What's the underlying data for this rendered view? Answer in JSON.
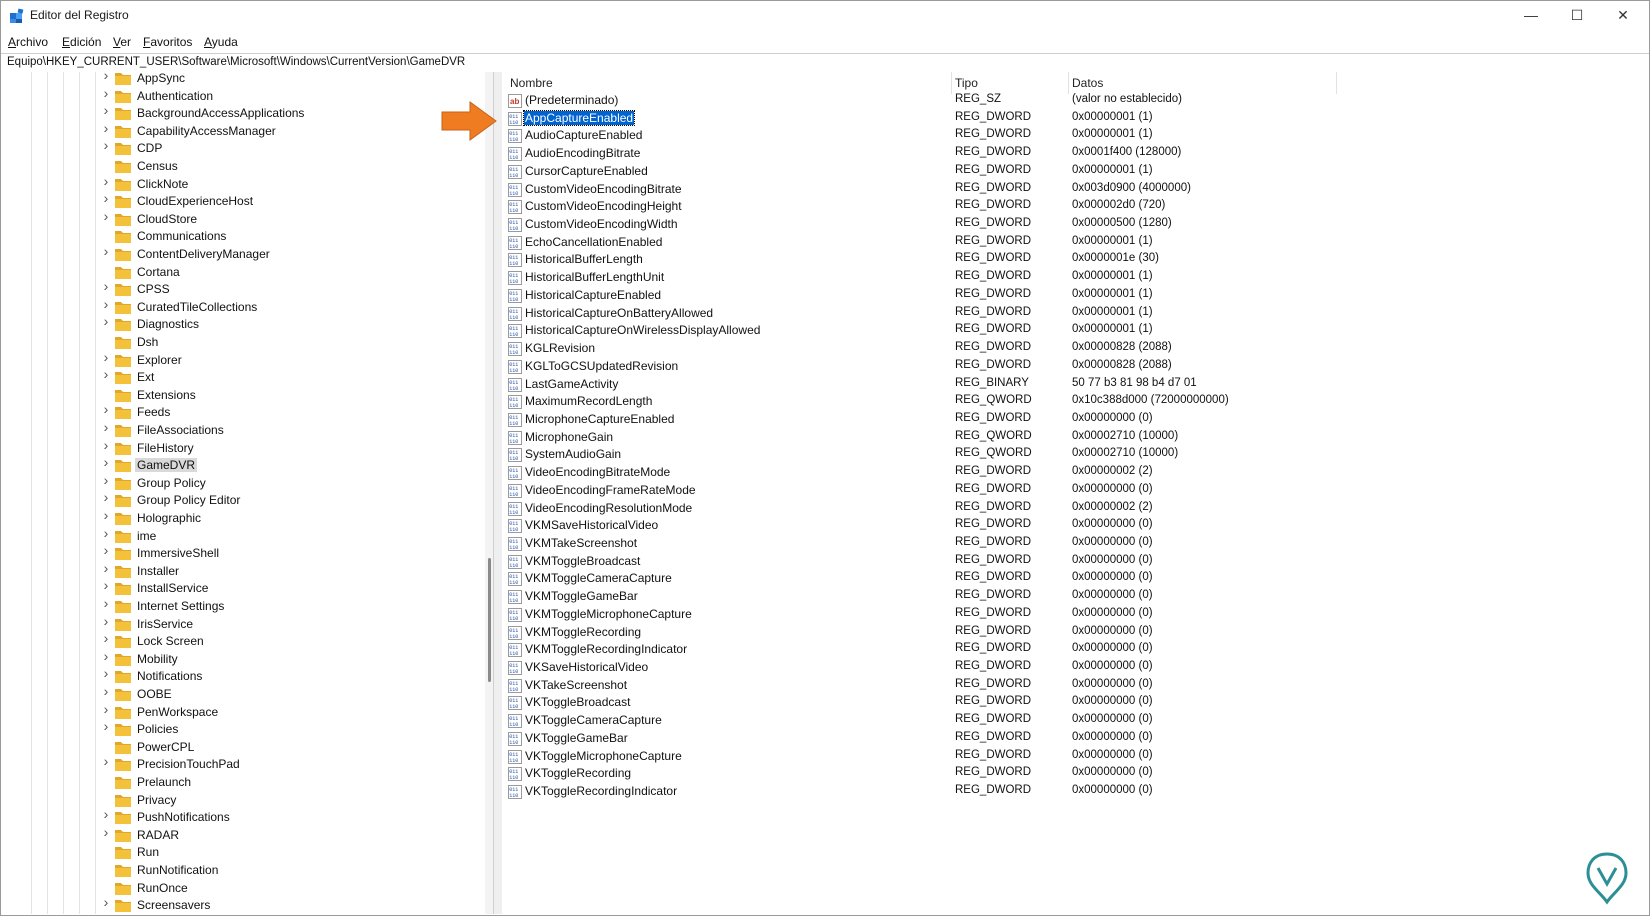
{
  "window": {
    "title": "Editor del Registro",
    "minimize_glyph": "—",
    "maximize_glyph": "☐",
    "close_glyph": "✕"
  },
  "menu": [
    {
      "label": "Archivo",
      "key": "A",
      "rest": "rchivo"
    },
    {
      "label": "Edición",
      "key": "E",
      "rest": "dición"
    },
    {
      "label": "Ver",
      "key": "V",
      "rest": "er"
    },
    {
      "label": "Favoritos",
      "key": "F",
      "rest": "avoritos"
    },
    {
      "label": "Ayuda",
      "key": "A",
      "rest": "yuda"
    }
  ],
  "address": "Equipo\\HKEY_CURRENT_USER\\Software\\Microsoft\\Windows\\CurrentVersion\\GameDVR",
  "tree": {
    "selected": "GameDVR",
    "items": [
      {
        "label": "AppSync",
        "expandable": true
      },
      {
        "label": "Authentication",
        "expandable": true
      },
      {
        "label": "BackgroundAccessApplications",
        "expandable": true
      },
      {
        "label": "CapabilityAccessManager",
        "expandable": true
      },
      {
        "label": "CDP",
        "expandable": true
      },
      {
        "label": "Census",
        "expandable": false
      },
      {
        "label": "ClickNote",
        "expandable": true
      },
      {
        "label": "CloudExperienceHost",
        "expandable": true
      },
      {
        "label": "CloudStore",
        "expandable": true
      },
      {
        "label": "Communications",
        "expandable": false
      },
      {
        "label": "ContentDeliveryManager",
        "expandable": true
      },
      {
        "label": "Cortana",
        "expandable": false
      },
      {
        "label": "CPSS",
        "expandable": true
      },
      {
        "label": "CuratedTileCollections",
        "expandable": true
      },
      {
        "label": "Diagnostics",
        "expandable": true
      },
      {
        "label": "Dsh",
        "expandable": false
      },
      {
        "label": "Explorer",
        "expandable": true
      },
      {
        "label": "Ext",
        "expandable": true
      },
      {
        "label": "Extensions",
        "expandable": false
      },
      {
        "label": "Feeds",
        "expandable": true
      },
      {
        "label": "FileAssociations",
        "expandable": true
      },
      {
        "label": "FileHistory",
        "expandable": true
      },
      {
        "label": "GameDVR",
        "expandable": true
      },
      {
        "label": "Group Policy",
        "expandable": true
      },
      {
        "label": "Group Policy Editor",
        "expandable": true
      },
      {
        "label": "Holographic",
        "expandable": true
      },
      {
        "label": "ime",
        "expandable": true
      },
      {
        "label": "ImmersiveShell",
        "expandable": true
      },
      {
        "label": "Installer",
        "expandable": true
      },
      {
        "label": "InstallService",
        "expandable": true
      },
      {
        "label": "Internet Settings",
        "expandable": true
      },
      {
        "label": "IrisService",
        "expandable": true
      },
      {
        "label": "Lock Screen",
        "expandable": true
      },
      {
        "label": "Mobility",
        "expandable": true
      },
      {
        "label": "Notifications",
        "expandable": true
      },
      {
        "label": "OOBE",
        "expandable": true
      },
      {
        "label": "PenWorkspace",
        "expandable": true
      },
      {
        "label": "Policies",
        "expandable": true
      },
      {
        "label": "PowerCPL",
        "expandable": false
      },
      {
        "label": "PrecisionTouchPad",
        "expandable": true
      },
      {
        "label": "Prelaunch",
        "expandable": false
      },
      {
        "label": "Privacy",
        "expandable": false
      },
      {
        "label": "PushNotifications",
        "expandable": true
      },
      {
        "label": "RADAR",
        "expandable": true
      },
      {
        "label": "Run",
        "expandable": false
      },
      {
        "label": "RunNotification",
        "expandable": false
      },
      {
        "label": "RunOnce",
        "expandable": false
      },
      {
        "label": "Screensavers",
        "expandable": true
      }
    ]
  },
  "columns": {
    "name": "Nombre",
    "type": "Tipo",
    "data": "Datos"
  },
  "values": [
    {
      "name": "(Predeterminado)",
      "type": "REG_SZ",
      "data": "(valor no establecido)",
      "icon": "string-value-icon"
    },
    {
      "name": "AppCaptureEnabled",
      "type": "REG_DWORD",
      "data": "0x00000001 (1)",
      "icon": "binary-value-icon",
      "selected": true
    },
    {
      "name": "AudioCaptureEnabled",
      "type": "REG_DWORD",
      "data": "0x00000001 (1)",
      "icon": "binary-value-icon"
    },
    {
      "name": "AudioEncodingBitrate",
      "type": "REG_DWORD",
      "data": "0x0001f400 (128000)",
      "icon": "binary-value-icon"
    },
    {
      "name": "CursorCaptureEnabled",
      "type": "REG_DWORD",
      "data": "0x00000001 (1)",
      "icon": "binary-value-icon"
    },
    {
      "name": "CustomVideoEncodingBitrate",
      "type": "REG_DWORD",
      "data": "0x003d0900 (4000000)",
      "icon": "binary-value-icon"
    },
    {
      "name": "CustomVideoEncodingHeight",
      "type": "REG_DWORD",
      "data": "0x000002d0 (720)",
      "icon": "binary-value-icon"
    },
    {
      "name": "CustomVideoEncodingWidth",
      "type": "REG_DWORD",
      "data": "0x00000500 (1280)",
      "icon": "binary-value-icon"
    },
    {
      "name": "EchoCancellationEnabled",
      "type": "REG_DWORD",
      "data": "0x00000001 (1)",
      "icon": "binary-value-icon"
    },
    {
      "name": "HistoricalBufferLength",
      "type": "REG_DWORD",
      "data": "0x0000001e (30)",
      "icon": "binary-value-icon"
    },
    {
      "name": "HistoricalBufferLengthUnit",
      "type": "REG_DWORD",
      "data": "0x00000001 (1)",
      "icon": "binary-value-icon"
    },
    {
      "name": "HistoricalCaptureEnabled",
      "type": "REG_DWORD",
      "data": "0x00000001 (1)",
      "icon": "binary-value-icon"
    },
    {
      "name": "HistoricalCaptureOnBatteryAllowed",
      "type": "REG_DWORD",
      "data": "0x00000001 (1)",
      "icon": "binary-value-icon"
    },
    {
      "name": "HistoricalCaptureOnWirelessDisplayAllowed",
      "type": "REG_DWORD",
      "data": "0x00000001 (1)",
      "icon": "binary-value-icon"
    },
    {
      "name": "KGLRevision",
      "type": "REG_DWORD",
      "data": "0x00000828 (2088)",
      "icon": "binary-value-icon"
    },
    {
      "name": "KGLToGCSUpdatedRevision",
      "type": "REG_DWORD",
      "data": "0x00000828 (2088)",
      "icon": "binary-value-icon"
    },
    {
      "name": "LastGameActivity",
      "type": "REG_BINARY",
      "data": "50 77 b3 81 98 b4 d7 01",
      "icon": "binary-value-icon"
    },
    {
      "name": "MaximumRecordLength",
      "type": "REG_QWORD",
      "data": "0x10c388d000 (72000000000)",
      "icon": "binary-value-icon"
    },
    {
      "name": "MicrophoneCaptureEnabled",
      "type": "REG_DWORD",
      "data": "0x00000000 (0)",
      "icon": "binary-value-icon"
    },
    {
      "name": "MicrophoneGain",
      "type": "REG_QWORD",
      "data": "0x00002710 (10000)",
      "icon": "binary-value-icon"
    },
    {
      "name": "SystemAudioGain",
      "type": "REG_QWORD",
      "data": "0x00002710 (10000)",
      "icon": "binary-value-icon"
    },
    {
      "name": "VideoEncodingBitrateMode",
      "type": "REG_DWORD",
      "data": "0x00000002 (2)",
      "icon": "binary-value-icon"
    },
    {
      "name": "VideoEncodingFrameRateMode",
      "type": "REG_DWORD",
      "data": "0x00000000 (0)",
      "icon": "binary-value-icon"
    },
    {
      "name": "VideoEncodingResolutionMode",
      "type": "REG_DWORD",
      "data": "0x00000002 (2)",
      "icon": "binary-value-icon"
    },
    {
      "name": "VKMSaveHistoricalVideo",
      "type": "REG_DWORD",
      "data": "0x00000000 (0)",
      "icon": "binary-value-icon"
    },
    {
      "name": "VKMTakeScreenshot",
      "type": "REG_DWORD",
      "data": "0x00000000 (0)",
      "icon": "binary-value-icon"
    },
    {
      "name": "VKMToggleBroadcast",
      "type": "REG_DWORD",
      "data": "0x00000000 (0)",
      "icon": "binary-value-icon"
    },
    {
      "name": "VKMToggleCameraCapture",
      "type": "REG_DWORD",
      "data": "0x00000000 (0)",
      "icon": "binary-value-icon"
    },
    {
      "name": "VKMToggleGameBar",
      "type": "REG_DWORD",
      "data": "0x00000000 (0)",
      "icon": "binary-value-icon"
    },
    {
      "name": "VKMToggleMicrophoneCapture",
      "type": "REG_DWORD",
      "data": "0x00000000 (0)",
      "icon": "binary-value-icon"
    },
    {
      "name": "VKMToggleRecording",
      "type": "REG_DWORD",
      "data": "0x00000000 (0)",
      "icon": "binary-value-icon"
    },
    {
      "name": "VKMToggleRecordingIndicator",
      "type": "REG_DWORD",
      "data": "0x00000000 (0)",
      "icon": "binary-value-icon"
    },
    {
      "name": "VKSaveHistoricalVideo",
      "type": "REG_DWORD",
      "data": "0x00000000 (0)",
      "icon": "binary-value-icon"
    },
    {
      "name": "VKTakeScreenshot",
      "type": "REG_DWORD",
      "data": "0x00000000 (0)",
      "icon": "binary-value-icon"
    },
    {
      "name": "VKToggleBroadcast",
      "type": "REG_DWORD",
      "data": "0x00000000 (0)",
      "icon": "binary-value-icon"
    },
    {
      "name": "VKToggleCameraCapture",
      "type": "REG_DWORD",
      "data": "0x00000000 (0)",
      "icon": "binary-value-icon"
    },
    {
      "name": "VKToggleGameBar",
      "type": "REG_DWORD",
      "data": "0x00000000 (0)",
      "icon": "binary-value-icon"
    },
    {
      "name": "VKToggleMicrophoneCapture",
      "type": "REG_DWORD",
      "data": "0x00000000 (0)",
      "icon": "binary-value-icon"
    },
    {
      "name": "VKToggleRecording",
      "type": "REG_DWORD",
      "data": "0x00000000 (0)",
      "icon": "binary-value-icon"
    },
    {
      "name": "VKToggleRecordingIndicator",
      "type": "REG_DWORD",
      "data": "0x00000000 (0)",
      "icon": "binary-value-icon"
    }
  ],
  "colors": {
    "selection_blue": "#0063cf",
    "tree_selection": "#d9d9d9",
    "folder_yellow": "#f3c13a",
    "arrow_orange": "#f07c22",
    "watermark_teal": "#2c8f96"
  }
}
